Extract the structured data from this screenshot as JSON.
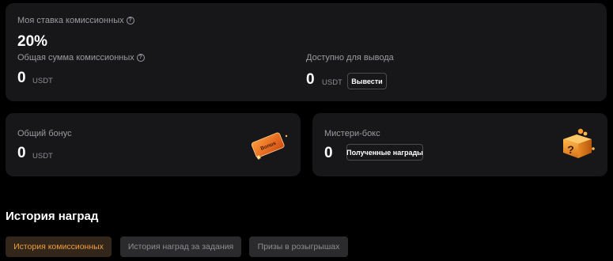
{
  "commission": {
    "rate_label": "Моя ставка комиссионных",
    "rate_value": "20%",
    "total_label": "Общая сумма комиссионных",
    "total_value": "0",
    "total_unit": "USDT",
    "available_label": "Доступно для вывода",
    "available_value": "0",
    "available_unit": "USDT",
    "withdraw_button": "Вывести"
  },
  "bonus": {
    "label": "Общий бонус",
    "value": "0",
    "unit": "USDT",
    "image_text": "Bonus",
    "icon": "bonus-ticket-icon"
  },
  "mystery_box": {
    "label": "Мистери-бокс",
    "value": "0",
    "button": "Полученные награды",
    "icon": "mystery-box-icon"
  },
  "rewards_history": {
    "title": "История наград",
    "tabs": [
      {
        "label": "История комиссионных",
        "active": true
      },
      {
        "label": "История наград за задания",
        "active": false
      },
      {
        "label": "Призы в розыгрышах",
        "active": false
      }
    ]
  },
  "colors": {
    "background": "#000000",
    "card": "#17171a",
    "accent": "#f0a03c",
    "muted_text": "#9b9ba1"
  }
}
